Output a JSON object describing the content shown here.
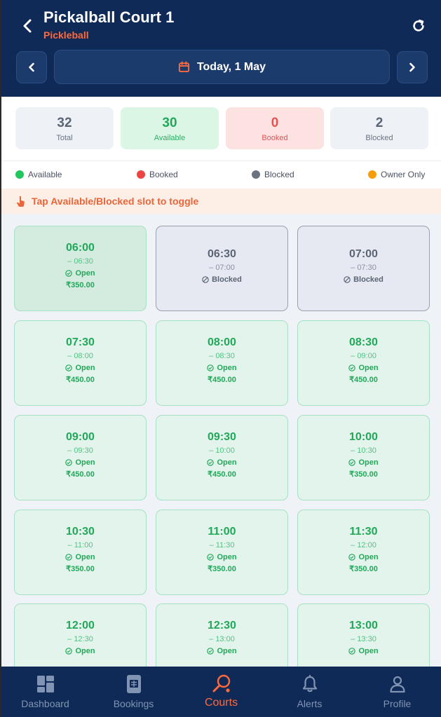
{
  "header": {
    "title": "Pickalball Court 1",
    "subtitle": "Pickleball",
    "date_label": "Today, 1 May"
  },
  "stats": {
    "total": {
      "value": "32",
      "label": "Total"
    },
    "available": {
      "value": "30",
      "label": "Available"
    },
    "booked": {
      "value": "0",
      "label": "Booked"
    },
    "blocked": {
      "value": "2",
      "label": "Blocked"
    }
  },
  "legend": {
    "available": "Available",
    "booked": "Booked",
    "blocked": "Blocked",
    "owner_only": "Owner Only"
  },
  "colors": {
    "header_bg": "#0f2a56",
    "accent": "#ff6a3d",
    "available": "#22c55e",
    "booked": "#ef4444",
    "blocked": "#6b7280",
    "owner_only": "#f59e0b"
  },
  "hint": "Tap Available/Blocked slot to toggle",
  "slots": [
    {
      "start": "06:00",
      "end": "– 06:30",
      "status": "Open",
      "price": "₹350.00"
    },
    {
      "start": "06:30",
      "end": "– 07:00",
      "status": "Blocked",
      "price": ""
    },
    {
      "start": "07:00",
      "end": "– 07:30",
      "status": "Blocked",
      "price": ""
    },
    {
      "start": "07:30",
      "end": "– 08:00",
      "status": "Open",
      "price": "₹450.00"
    },
    {
      "start": "08:00",
      "end": "– 08:30",
      "status": "Open",
      "price": "₹450.00"
    },
    {
      "start": "08:30",
      "end": "– 09:00",
      "status": "Open",
      "price": "₹450.00"
    },
    {
      "start": "09:00",
      "end": "– 09:30",
      "status": "Open",
      "price": "₹450.00"
    },
    {
      "start": "09:30",
      "end": "– 10:00",
      "status": "Open",
      "price": "₹450.00"
    },
    {
      "start": "10:00",
      "end": "– 10:30",
      "status": "Open",
      "price": "₹350.00"
    },
    {
      "start": "10:30",
      "end": "– 11:00",
      "status": "Open",
      "price": "₹350.00"
    },
    {
      "start": "11:00",
      "end": "– 11:30",
      "status": "Open",
      "price": "₹350.00"
    },
    {
      "start": "11:30",
      "end": "– 12:00",
      "status": "Open",
      "price": "₹350.00"
    },
    {
      "start": "12:00",
      "end": "– 12:30",
      "status": "Open",
      "price": ""
    },
    {
      "start": "12:30",
      "end": "– 13:00",
      "status": "Open",
      "price": ""
    },
    {
      "start": "13:00",
      "end": "– 13:30",
      "status": "Open",
      "price": ""
    }
  ],
  "bottom_nav": {
    "dashboard": "Dashboard",
    "bookings": "Bookings",
    "courts": "Courts",
    "alerts": "Alerts",
    "profile": "Profile"
  }
}
